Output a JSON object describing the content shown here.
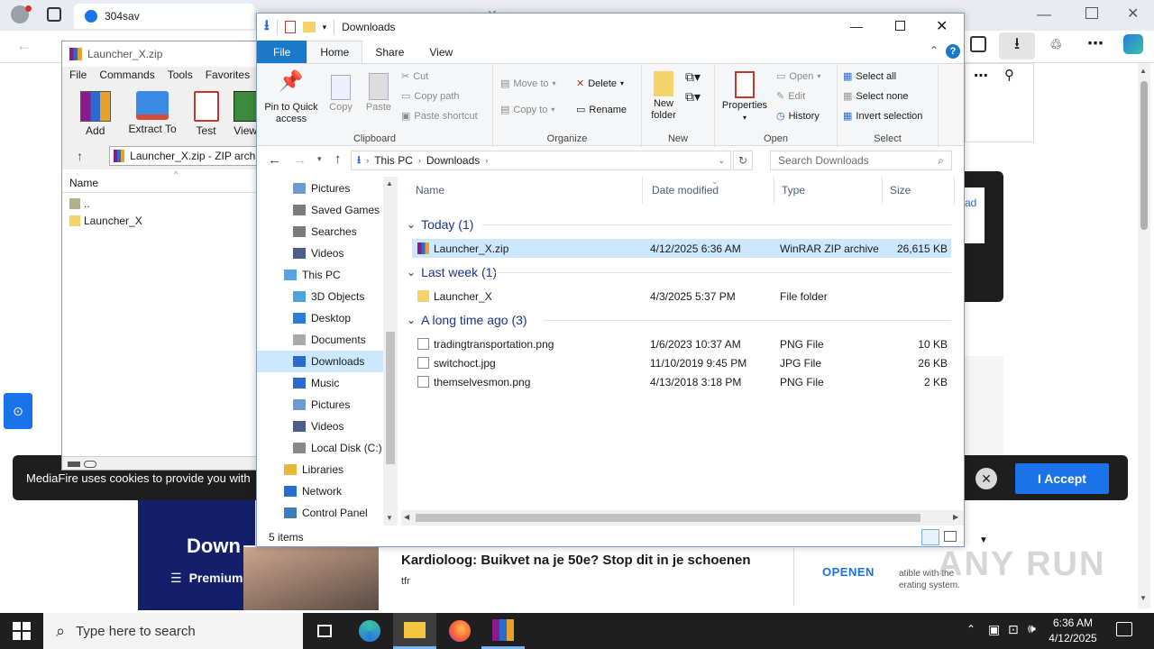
{
  "browser": {
    "tab_title": "304sav",
    "colors": {
      "accent": "#1a73e8"
    }
  },
  "background_page": {
    "cookie_text": "MediaFire uses cookies to provide you with",
    "accept_label": "I Accept",
    "close_label": "✕",
    "banner_title": "Down",
    "banner_sub": "Premium",
    "ad_title": "Kardioloog: Buikvet na je 50e? Stop dit in je schoenen",
    "ad_source": "tfr",
    "ad_button": "OPENEN",
    "side_text_1": "atible with the",
    "side_text_2": "erating system.",
    "dark_card_text": "ad"
  },
  "winrar": {
    "title": "Launcher_X.zip",
    "menu": [
      "File",
      "Commands",
      "Tools",
      "Favorites"
    ],
    "toolbar": [
      "Add",
      "Extract To",
      "Test",
      "View"
    ],
    "path": "Launcher_X.zip - ZIP archi",
    "column_name": "Name",
    "rows": [
      "..",
      "Launcher_X"
    ]
  },
  "explorer": {
    "title": "Downloads",
    "tabs": [
      "File",
      "Home",
      "Share",
      "View"
    ],
    "ribbon": {
      "clipboard": {
        "label": "Clipboard",
        "pin": "Pin to Quick access",
        "copy": "Copy",
        "paste": "Paste",
        "cut": "Cut",
        "copy_path": "Copy path",
        "paste_shortcut": "Paste shortcut"
      },
      "organize": {
        "label": "Organize",
        "move_to": "Move to",
        "copy_to": "Copy to",
        "delete": "Delete",
        "rename": "Rename"
      },
      "new": {
        "label": "New",
        "new_folder": "New folder"
      },
      "open": {
        "label": "Open",
        "properties": "Properties",
        "open": "Open",
        "edit": "Edit",
        "history": "History"
      },
      "select": {
        "label": "Select",
        "select_all": "Select all",
        "select_none": "Select none",
        "invert": "Invert selection"
      }
    },
    "address": {
      "crumbs": [
        "This PC",
        "Downloads"
      ],
      "search_placeholder": "Search Downloads"
    },
    "nav": [
      {
        "label": "Pictures"
      },
      {
        "label": "Saved Games"
      },
      {
        "label": "Searches"
      },
      {
        "label": "Videos"
      },
      {
        "label": "This PC"
      },
      {
        "label": "3D Objects"
      },
      {
        "label": "Desktop"
      },
      {
        "label": "Documents"
      },
      {
        "label": "Downloads"
      },
      {
        "label": "Music"
      },
      {
        "label": "Pictures"
      },
      {
        "label": "Videos"
      },
      {
        "label": "Local Disk (C:)"
      },
      {
        "label": "Libraries"
      },
      {
        "label": "Network"
      },
      {
        "label": "Control Panel"
      }
    ],
    "columns": [
      "Name",
      "Date modified",
      "Type",
      "Size"
    ],
    "groups": [
      {
        "title": "Today (1)",
        "files": [
          {
            "name": "Launcher_X.zip",
            "date": "4/12/2025 6:36 AM",
            "type": "WinRAR ZIP archive",
            "size": "26,615 KB"
          }
        ]
      },
      {
        "title": "Last week (1)",
        "files": [
          {
            "name": "Launcher_X",
            "date": "4/3/2025 5:37 PM",
            "type": "File folder",
            "size": ""
          }
        ]
      },
      {
        "title": "A long time ago (3)",
        "files": [
          {
            "name": "tradingtransportation.png",
            "date": "1/6/2023 10:37 AM",
            "type": "PNG File",
            "size": "10 KB"
          },
          {
            "name": "switchoct.jpg",
            "date": "11/10/2019 9:45 PM",
            "type": "JPG File",
            "size": "26 KB"
          },
          {
            "name": "themselvesmon.png",
            "date": "4/13/2018 3:18 PM",
            "type": "PNG File",
            "size": "2 KB"
          }
        ]
      }
    ],
    "status": "5 items"
  },
  "taskbar": {
    "search_placeholder": "Type here to search",
    "time": "6:36 AM",
    "date": "4/12/2025"
  },
  "watermark": "ANY RUN"
}
